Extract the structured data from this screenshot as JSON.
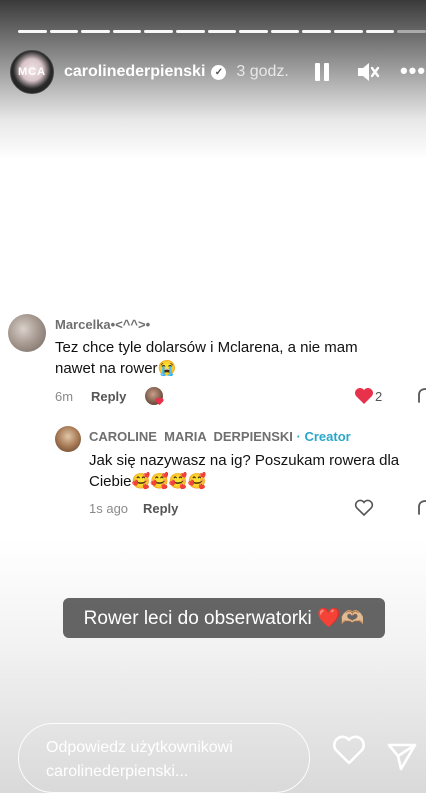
{
  "story": {
    "progress_segments": 13,
    "progress_active": 12
  },
  "header": {
    "avatar_text": "MCA",
    "username": "carolinederpienski",
    "time": "3 godz.",
    "icons": [
      "verified-icon",
      "pause-icon",
      "mute-icon",
      "more-icon"
    ]
  },
  "comment": {
    "author": "Marcelka•<^^>•",
    "text_line1": "Tez chce tyle dolarsów i Mclarena, a nie mam",
    "text_line2": "nawet na rower😭",
    "age": "6m",
    "reply_label": "Reply",
    "like_count": "2"
  },
  "reply": {
    "author": "CAROLINE  MARIA  DERPIENSKI",
    "creator_label": "· Creator",
    "text_line1": "Jak się nazywasz na ig? Poszukam rowera dla",
    "text_line2": "Ciebie🥰🥰🥰🥰",
    "age": "1s ago",
    "reply_label": "Reply"
  },
  "caption": "Rower leci do obserwatorki ❤️🫶🏼",
  "footer": {
    "reply_placeholder_line1": "Odpowiedz użytkownikowi",
    "reply_placeholder_line2": "carolinederpienski..."
  },
  "colors": {
    "creator": "#2aa7c9",
    "like_heart": "#e8314b"
  }
}
